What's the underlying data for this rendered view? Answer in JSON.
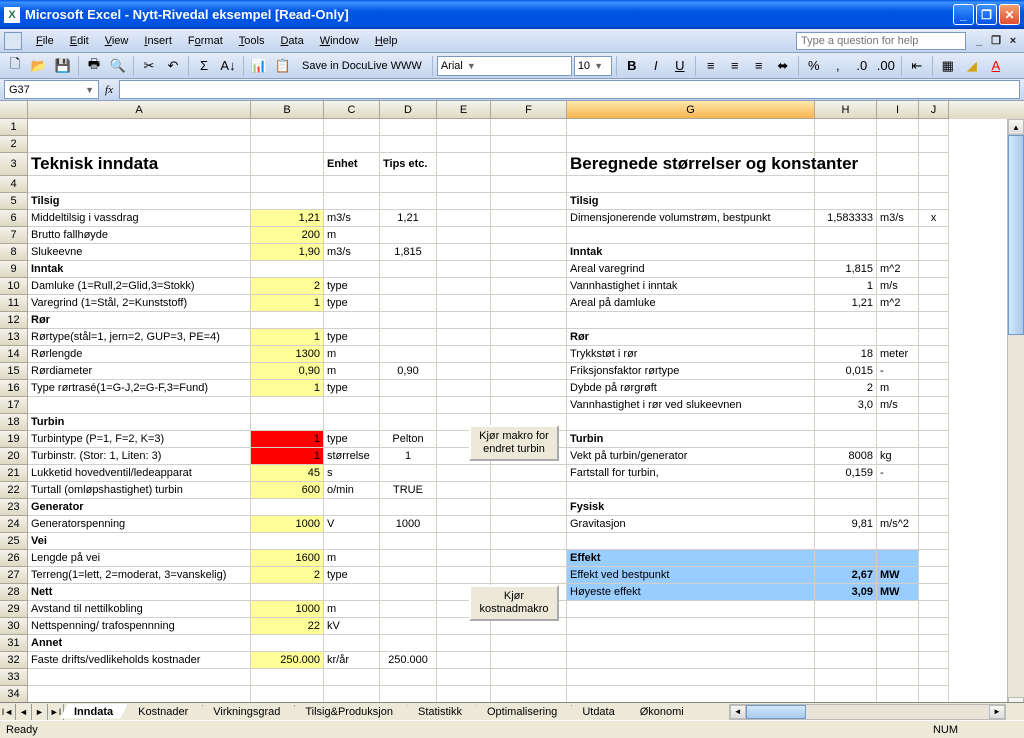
{
  "window": {
    "title": "Microsoft Excel - Nytt-Rivedal eksempel  [Read-Only]"
  },
  "menu": {
    "file": "File",
    "edit": "Edit",
    "view": "View",
    "insert": "Insert",
    "format": "Format",
    "tools": "Tools",
    "data": "Data",
    "window": "Window",
    "help": "Help",
    "help_placeholder": "Type a question for help"
  },
  "toolbar": {
    "save_dl": "Save in DocuLive WWW",
    "font": "Arial",
    "size": "10"
  },
  "namebox": "G37",
  "cols": [
    "A",
    "B",
    "C",
    "D",
    "E",
    "F",
    "G",
    "H",
    "I",
    "J"
  ],
  "rows_hdr": [
    "1",
    "2",
    "3",
    "4",
    "5",
    "6",
    "7",
    "8",
    "9",
    "10",
    "11",
    "12",
    "13",
    "14",
    "15",
    "16",
    "17",
    "18",
    "19",
    "20",
    "21",
    "22",
    "23",
    "24",
    "25",
    "26",
    "27",
    "28",
    "29",
    "30",
    "31",
    "32",
    "33",
    "34"
  ],
  "h": {
    "teknisk": "Teknisk inndata",
    "enhet": "Enhet",
    "tips": "Tips etc.",
    "beregnede": "Beregnede størrelser og konstanter",
    "tilsig": "Tilsig",
    "inntak": "Inntak",
    "ror": "Rør",
    "turbin": "Turbin",
    "generator": "Generator",
    "vei": "Vei",
    "nett": "Nett",
    "annet": "Annet",
    "fysisk": "Fysisk",
    "effekt": "Effekt"
  },
  "r": {
    "a6": "Middeltilsig i vassdrag",
    "b6": "1,21",
    "c6": "m3/s",
    "d6": "1,21",
    "g6": "Dimensjonerende volumstrøm, bestpunkt",
    "h6": "1,583333",
    "i6": "m3/s",
    "j6": "x",
    "a7": "Brutto fallhøyde",
    "b7": "200",
    "c7": "m",
    "a8": "Slukeevne",
    "b8": "1,90",
    "c8": "m3/s",
    "d8": "1,815",
    "g9": "Areal varegrind",
    "h9": "1,815",
    "i9": "m^2",
    "a10": "Damluke (1=Rull,2=Glid,3=Stokk)",
    "b10": "2",
    "c10": "type",
    "g10": "Vannhastighet i inntak",
    "h10": "1",
    "i10": "m/s",
    "a11": "Varegrind (1=Stål, 2=Kunststoff)",
    "b11": "1",
    "c11": "type",
    "g11": "Areal på damluke",
    "h11": "1,21",
    "i11": "m^2",
    "a13": "Rørtype(stål=1, jern=2, GUP=3, PE=4)",
    "b13": "1",
    "c13": "type",
    "a14": "Rørlengde",
    "b14": "1300",
    "c14": "m",
    "g14": "Trykkstøt i rør",
    "h14": "18",
    "i14": "meter",
    "a15": "Rørdiameter",
    "b15": "0,90",
    "c15": "m",
    "d15": "0,90",
    "g15": "Friksjonsfaktor rørtype",
    "h15": "0,015",
    "i15": "-",
    "a16": "Type rørtrasé(1=G-J,2=G-F,3=Fund)",
    "b16": "1",
    "c16": "type",
    "g16": "Dybde på rørgrøft",
    "h16": "2",
    "i16": "m",
    "g17": "Vannhastighet i rør ved slukeevnen",
    "h17": "3,0",
    "i17": "m/s",
    "a19": "Turbintype (P=1, F=2, K=3)",
    "b19": "1",
    "c19": "type",
    "d19": "Pelton",
    "a20": "Turbinstr. (Stor: 1, Liten: 3)",
    "b20": "1",
    "c20": "størrelse",
    "d20": "1",
    "g20": "Vekt på turbin/generator",
    "h20": "8008",
    "i20": "kg",
    "a21": "Lukketid hovedventil/ledeapparat",
    "b21": "45",
    "c21": "s",
    "g21": "Fartstall for turbin,",
    "h21": "0,159",
    "i21": "-",
    "a22": "Turtall (omløpshastighet) turbin",
    "b22": "600",
    "c22": "o/min",
    "d22": "TRUE",
    "a24": "Generatorspenning",
    "b24": "1000",
    "c24": "V",
    "d24": "1000",
    "g24": "Gravitasjon",
    "h24": "9,81",
    "i24": "m/s^2",
    "a26": "Lengde på vei",
    "b26": "1600",
    "c26": "m",
    "a27": "Terreng(1=lett, 2=moderat, 3=vanskelig)",
    "b27": "2",
    "c27": "type",
    "g27": "Effekt ved bestpunkt",
    "h27": "2,67",
    "i27": "MW",
    "g28": "Høyeste effekt",
    "h28": "3,09",
    "i28": "MW",
    "a29": "Avstand til nettilkobling",
    "b29": "1000",
    "c29": "m",
    "a30": "Nettspenning/ trafospennning",
    "b30": "22",
    "c30": "kV",
    "a32": "Faste drifts/vedlikeholds kostnader",
    "b32": "250.000",
    "c32": "kr/år",
    "d32": "250.000"
  },
  "buttons": {
    "turbin_macro": "Kjør makro for endret turbin",
    "kost_macro": "Kjør kostnadmakro"
  },
  "tabs": [
    "Inndata",
    "Kostnader",
    "Virkningsgrad",
    "Tilsig&Produksjon",
    "Statistikk",
    "Optimalisering",
    "Utdata",
    "Økonomi"
  ],
  "status": {
    "ready": "Ready",
    "num": "NUM"
  }
}
